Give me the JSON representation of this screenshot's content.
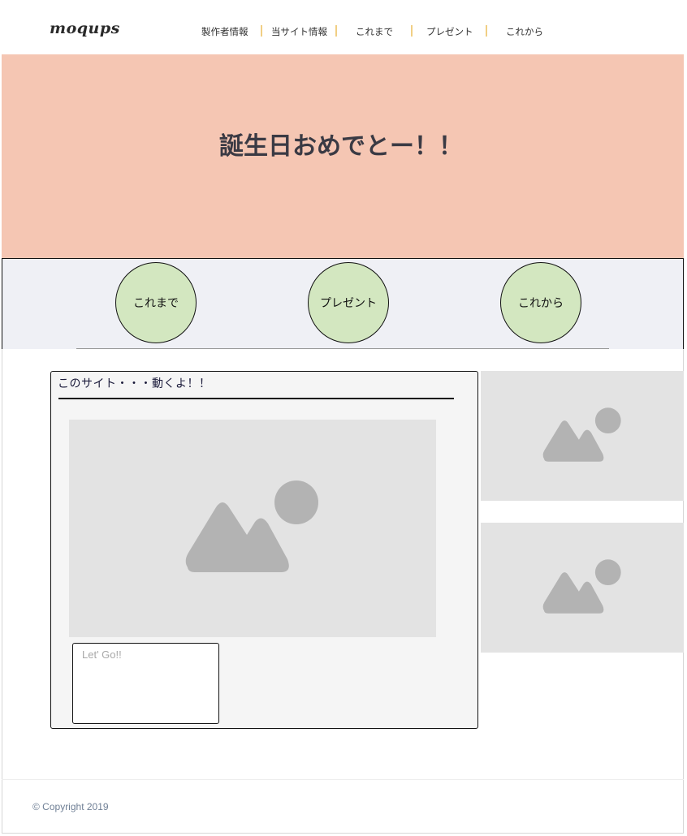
{
  "header": {
    "logo": "moqups",
    "nav": [
      "製作者情報",
      "当サイト情報",
      "これまで",
      "プレゼント",
      "これから"
    ]
  },
  "hero": {
    "title": "誕生日おめでとー！！"
  },
  "circles": [
    "これまで",
    "プレゼント",
    "これから"
  ],
  "panel": {
    "title": "このサイト・・・動くよ！！",
    "input_placeholder": "Let' Go!!"
  },
  "icons": {
    "image_placeholder": "image-placeholder-icon"
  },
  "colors": {
    "hero_bg": "#f5c6b3",
    "band_bg": "#eff0f5",
    "circle_fill": "#d3e7c0",
    "nav_separator": "#f1cf84",
    "panel_bg": "#f5f5f5",
    "placeholder_bg": "#e3e3e3"
  },
  "footer": {
    "copyright": "© Copyright 2019"
  }
}
